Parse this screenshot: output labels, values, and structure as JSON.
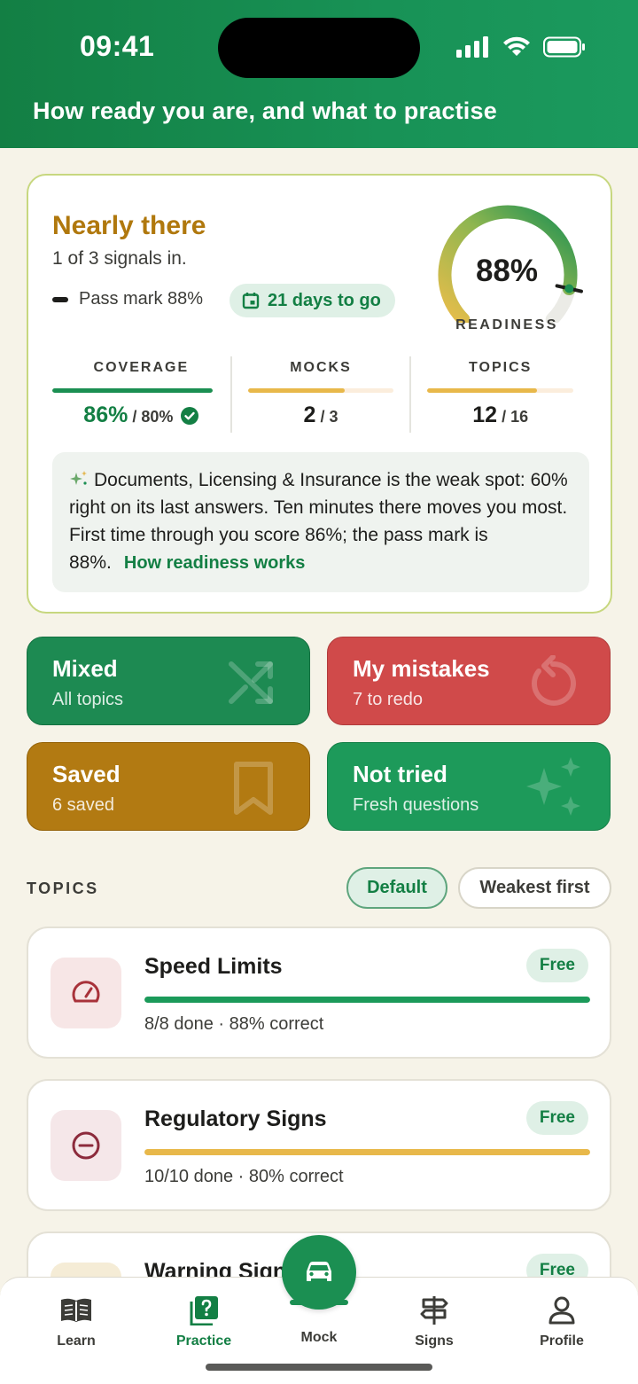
{
  "status_bar": {
    "time": "09:41"
  },
  "header": {
    "subtitle": "How ready you are, and what to practise"
  },
  "readiness": {
    "title": "Nearly there",
    "signals": "1 of 3 signals in.",
    "pass_mark": "Pass mark 88%",
    "days_to_go": "21 days to go",
    "gauge_value": "88%",
    "gauge_fraction": 0.88,
    "gauge_label": "READINESS",
    "stats": [
      {
        "label": "COVERAGE",
        "value": "86%",
        "of": "/ 80%",
        "progress": 1.0,
        "color": "#1b8f52"
      },
      {
        "label": "MOCKS",
        "value": "2",
        "of": "/ 3",
        "progress": 0.6667,
        "color": "#e8b84a"
      },
      {
        "label": "TOPICS",
        "value": "12",
        "of": "/ 16",
        "progress": 0.75,
        "color": "#e8b84a"
      }
    ],
    "insight": "Documents, Licensing & Insurance is the weak spot: 60% right on its last answers. Ten minutes there moves you most. First time through you score 86%; the pass mark is 88%.",
    "insight_link": "How readiness works"
  },
  "tiles": {
    "mixed": {
      "title": "Mixed",
      "sub": "All topics"
    },
    "mistakes": {
      "title": "My mistakes",
      "sub": "7 to redo"
    },
    "saved": {
      "title": "Saved",
      "sub": "6 saved"
    },
    "not_tried": {
      "title": "Not tried",
      "sub": "Fresh questions"
    }
  },
  "topics": {
    "heading": "TOPICS",
    "sort_default": "Default",
    "sort_weakest": "Weakest first",
    "items": [
      {
        "title": "Speed Limits",
        "badge": "Free",
        "meta": "8/8 done · 88% correct",
        "progress": 1.0,
        "color": "#1b9a5a"
      },
      {
        "title": "Regulatory Signs",
        "badge": "Free",
        "meta": "10/10 done · 80% correct",
        "progress": 1.0,
        "color": "#e8b84a"
      },
      {
        "title": "Warning Signs",
        "badge": "Free"
      }
    ]
  },
  "nav": {
    "learn": "Learn",
    "practice": "Practice",
    "mock": "Mock",
    "signs": "Signs",
    "profile": "Profile"
  }
}
